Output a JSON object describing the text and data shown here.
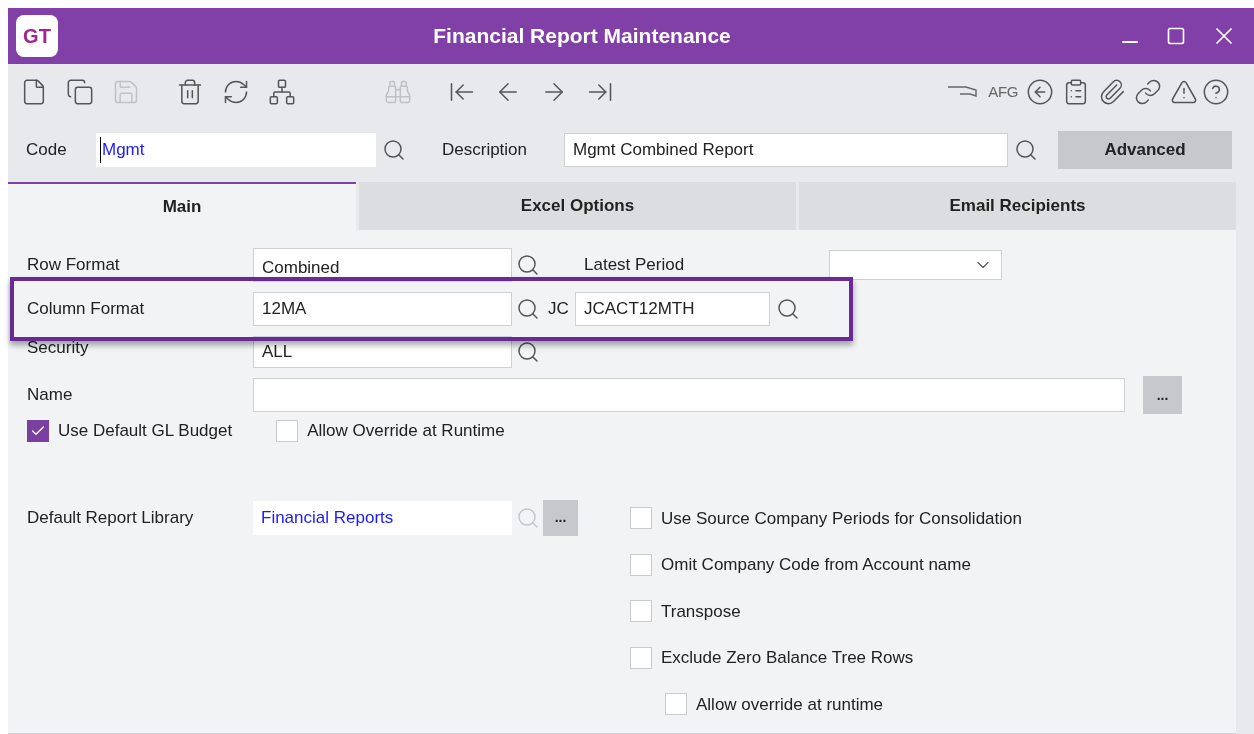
{
  "window": {
    "logo": "GT",
    "title": "Financial Report Maintenance"
  },
  "toolbar": {
    "left": [
      {
        "disabled": false
      },
      {
        "disabled": false
      },
      {
        "disabled": true
      },
      {
        "disabled": false
      },
      {
        "disabled": false
      },
      {
        "disabled": false
      },
      {
        "disabled": true
      },
      {
        "disabled": false
      },
      {
        "disabled": false
      },
      {
        "disabled": false
      },
      {
        "disabled": false
      }
    ],
    "afg_label": "AFG"
  },
  "header": {
    "code_label": "Code",
    "code_value": "Mgmt",
    "description_label": "Description",
    "description_value": "Mgmt Combined Report",
    "advanced_button": "Advanced"
  },
  "tabs": [
    {
      "label": "Main",
      "selected": true
    },
    {
      "label": "Excel Options",
      "selected": false
    },
    {
      "label": "Email Recipients",
      "selected": false
    }
  ],
  "form": {
    "row_format_label": "Row Format",
    "row_format_value": "Combined",
    "latest_period_label": "Latest Period",
    "column_format_label": "Column Format",
    "column_format_value": "12MA",
    "jc_label": "JC",
    "jc_value": "JCACT12MTH",
    "security_label": "Security",
    "security_value": "ALL",
    "name_label": "Name",
    "name_button": "...",
    "budget_checks": [
      {
        "label": "Use Default GL Budget",
        "checked": true
      },
      {
        "label": "Allow Override at Runtime",
        "checked": false
      }
    ],
    "library_label": "Default Report Library",
    "library_value": "Financial Reports",
    "library_button": "...",
    "options": [
      {
        "label": "Use Source Company Periods for Consolidation",
        "checked": false
      },
      {
        "label": "Omit Company Code from Account name",
        "checked": false
      },
      {
        "label": "Transpose",
        "checked": false
      },
      {
        "label": "Exclude Zero Balance Tree Rows",
        "checked": false,
        "children": [
          {
            "label": "Allow override at runtime",
            "checked": false
          }
        ]
      }
    ]
  }
}
